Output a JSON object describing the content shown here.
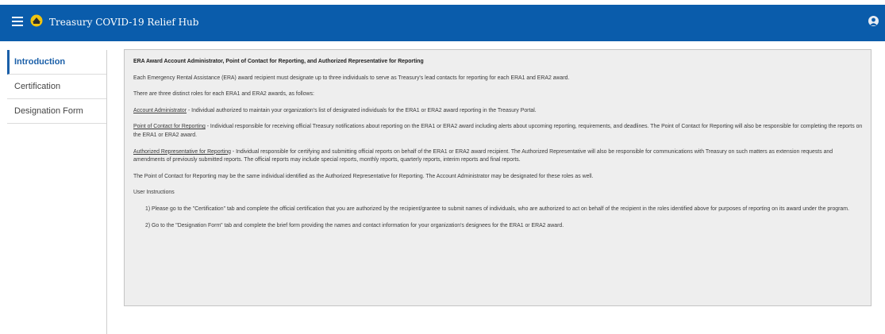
{
  "header": {
    "title": "Treasury COVID-19 Relief Hub",
    "menu_icon": "hamburger-menu-icon",
    "logo_icon": "treasury-seal-icon",
    "user_icon": "user-avatar-icon",
    "color": "#0a5cab"
  },
  "sidebar": {
    "items": [
      {
        "label": "Introduction",
        "active": true
      },
      {
        "label": "Certification",
        "active": false
      },
      {
        "label": "Designation Form",
        "active": false
      }
    ],
    "active_color": "#1a5fa8"
  },
  "content": {
    "title": "ERA Award Account Administrator, Point of Contact for Reporting, and Authorized Representative for Reporting",
    "intro": "Each Emergency Rental Assistance (ERA) award recipient must designate up to three individuals to serve as Treasury's lead contacts for reporting for each ERA1 and ERA2 award.",
    "roles_intro": "There are three distinct roles for each ERA1 and ERA2 awards, as follows:",
    "roles": [
      {
        "term": "Account Administrator",
        "description": " - Individual authorized to maintain your organization's list of designated individuals for the ERA1 or ERA2 award reporting in the Treasury Portal."
      },
      {
        "term": "Point of Contact for Reporting",
        "description": " - Individual responsible for receiving official Treasury notifications about reporting on the ERA1 or ERA2 award including alerts about upcoming reporting, requirements, and deadlines. The Point of Contact for Reporting will also be responsible for completing the reports on the ERA1 or ERA2 award."
      },
      {
        "term": "Authorized Representative for Reporting",
        "description": " - Individual responsible for certifying and submitting official reports on behalf of the ERA1 or ERA2 award recipient. The Authorized Representative will also be responsible for communications with Treasury on such matters as extension requests and amendments of previously submitted reports. The official reports may include special reports, monthly reports, quarterly reports, interim reports and final reports."
      }
    ],
    "note": "The Point of Contact for Reporting may be the same individual identified as the Authorized Representative for Reporting. The Account Administrator may be designated for these roles as well.",
    "instructions_heading": "User Instructions",
    "instructions": [
      "1) Please go to the \"Certification\" tab and complete the official certification that you are authorized by the recipient/grantee to submit names of individuals, who are authorized to act on behalf of the recipient in the roles identified above for purposes of reporting on its award under the program.",
      "2) Go to the \"Designation Form\" tab and complete the brief form providing the names and contact information for your organization's designees for the ERA1 or ERA2 award."
    ]
  }
}
